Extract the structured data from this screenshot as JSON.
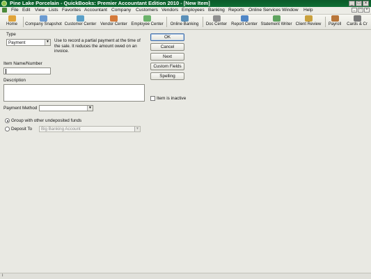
{
  "window": {
    "title": "Pine Lake Porcelain  - QuickBooks: Premier Accountant Edition 2010 - [New Item]"
  },
  "menu": [
    "File",
    "Edit",
    "View",
    "Lists",
    "Favorites",
    "Accountant",
    "Company",
    "Customers",
    "Vendors",
    "Employees",
    "Banking",
    "Reports",
    "Online Services",
    "Window",
    "Help"
  ],
  "toolbar": [
    {
      "label": "Home",
      "icon": "home-icon",
      "color": "#e0a43a"
    },
    {
      "label": "Company Snapshot",
      "icon": "company-snapshot-icon",
      "color": "#6c9bd1"
    },
    {
      "label": "Customer Center",
      "icon": "customer-center-icon",
      "color": "#5aa0c8"
    },
    {
      "label": "Vendor Center",
      "icon": "vendor-center-icon",
      "color": "#d47a3a"
    },
    {
      "label": "Employee Center",
      "icon": "employee-center-icon",
      "color": "#6bb36b"
    },
    {
      "label": "Online Banking",
      "icon": "online-banking-icon",
      "color": "#5a8fb8"
    },
    {
      "label": "Doc Center",
      "icon": "doc-center-icon",
      "color": "#8f8f8f"
    },
    {
      "label": "Report Center",
      "icon": "report-center-icon",
      "color": "#4f86c6"
    },
    {
      "label": "Statement Writer",
      "icon": "statement-writer-icon",
      "color": "#5fa35f"
    },
    {
      "label": "Client Review",
      "icon": "client-review-icon",
      "color": "#c9a03c"
    },
    {
      "label": "Payroll",
      "icon": "payroll-icon",
      "color": "#b8763a"
    },
    {
      "label": "Cards & Cr",
      "icon": "cards-icon",
      "color": "#7a7a7a"
    }
  ],
  "form": {
    "type_label": "Type",
    "type_value": "Payment",
    "type_description": "Use to record a partial payment at the time of the sale. It reduces the amount owed on an invoice.",
    "item_name_label": "Item Name/Number",
    "item_name_value": "",
    "description_label": "Description",
    "description_value": "",
    "payment_method_label": "Payment Method",
    "payment_method_value": "",
    "group_label": "Group with other undeposited funds",
    "deposit_to_label": "Deposit To",
    "deposit_to_value": "Big Banking Account",
    "inactive_label": "Item is inactive"
  },
  "buttons": {
    "ok": "OK",
    "cancel": "Cancel",
    "next": "Next",
    "custom_fields": "Custom Fields",
    "spelling": "Spelling"
  }
}
